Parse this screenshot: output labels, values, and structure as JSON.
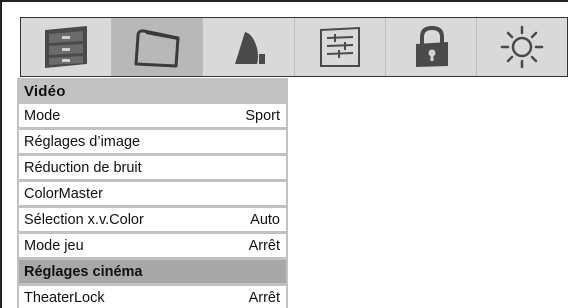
{
  "tabs": [
    {
      "icon": "cabinet-icon",
      "selected": false
    },
    {
      "icon": "picture-icon",
      "selected": true
    },
    {
      "icon": "speaker-icon",
      "selected": false
    },
    {
      "icon": "preferences-icon",
      "selected": false
    },
    {
      "icon": "lock-icon",
      "selected": false
    },
    {
      "icon": "sun-settings-icon",
      "selected": false
    }
  ],
  "menu": {
    "title": "Vidéo",
    "items": [
      {
        "label": "Mode",
        "value": "Sport"
      },
      {
        "label": "Réglages d’image",
        "value": ""
      },
      {
        "label": "Réduction de bruit",
        "value": ""
      },
      {
        "label": "ColorMaster",
        "value": ""
      },
      {
        "label": "Sélection x.v.Color",
        "value": "Auto"
      },
      {
        "label": "Mode jeu",
        "value": "Arrêt"
      },
      {
        "label": "Réglages cinéma",
        "value": ""
      },
      {
        "label": "TheaterLock",
        "value": "Arrêt"
      }
    ],
    "highlighted_index": 6
  },
  "colors": {
    "tabbar_bg": "#d9d9d9",
    "tab_selected_bg": "#b8b8b8",
    "menu_bg": "#c2c2c2",
    "row_highlight_bg": "#a8a8a8",
    "icon_fill": "#4a4a4a"
  }
}
